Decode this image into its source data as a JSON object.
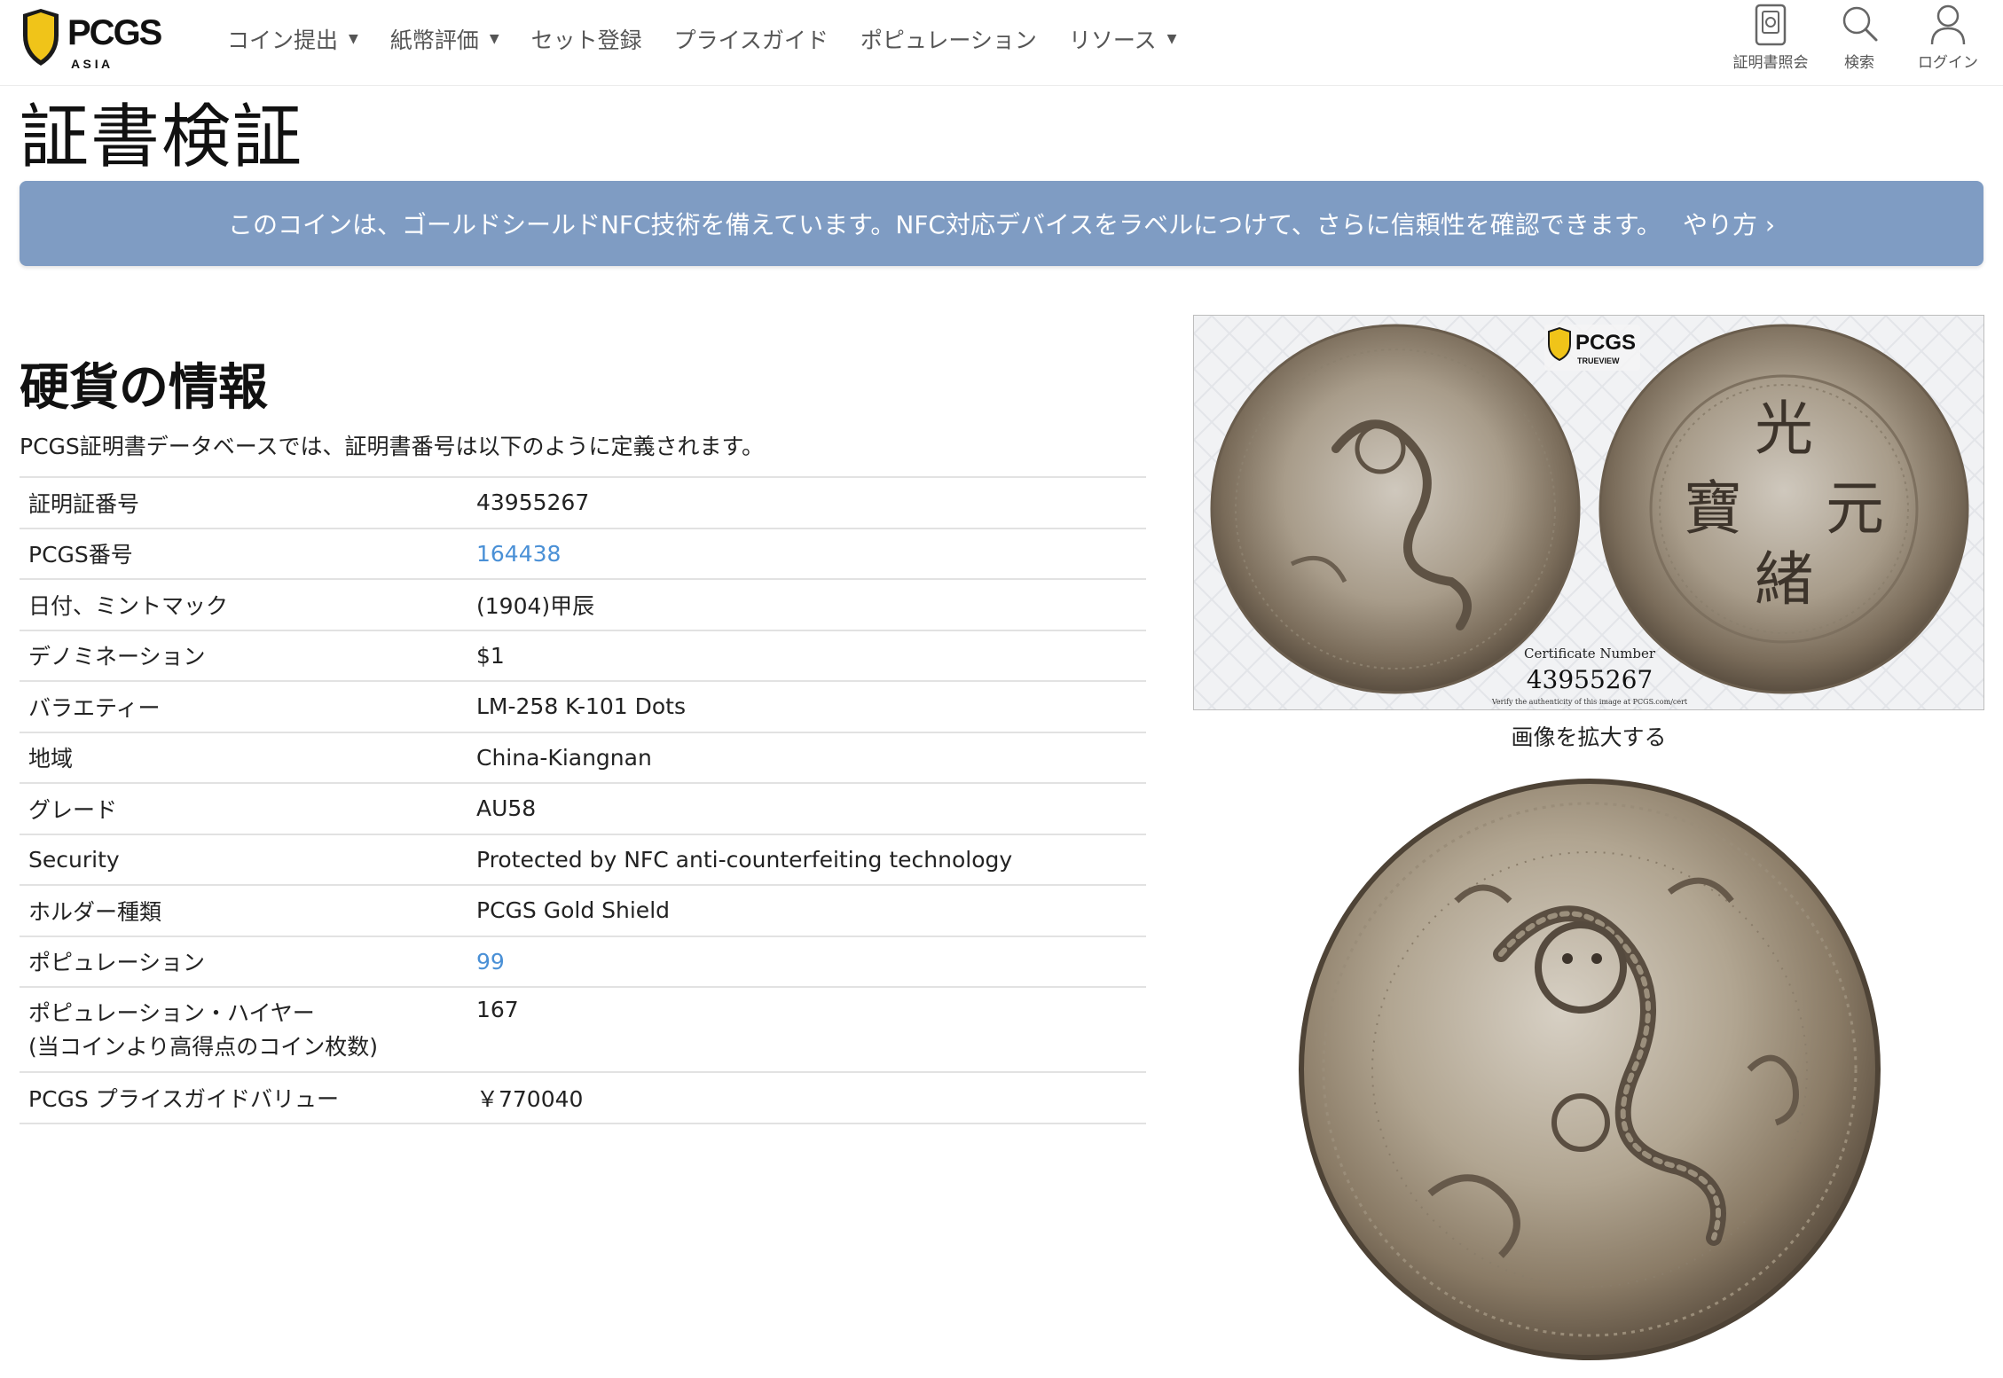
{
  "header": {
    "logo": {
      "brand": "PCGS",
      "sub": "A S I A"
    },
    "nav": [
      {
        "label": "コイン提出",
        "dropdown": true
      },
      {
        "label": "紙幣評価",
        "dropdown": true
      },
      {
        "label": "セット登録",
        "dropdown": false
      },
      {
        "label": "プライスガイド",
        "dropdown": false
      },
      {
        "label": "ポピュレーション",
        "dropdown": false
      },
      {
        "label": "リソース",
        "dropdown": true
      }
    ],
    "icons": [
      {
        "label": "証明書照会",
        "icon": "certificate-icon"
      },
      {
        "label": "検索",
        "icon": "search-icon"
      },
      {
        "label": "ログイン",
        "icon": "user-icon"
      }
    ]
  },
  "page": {
    "title": "証書検証"
  },
  "banner": {
    "text": "このコインは、ゴールドシールドNFC技術を備えています。NFC対応デバイスをラベルにつけて、さらに信頼性を確認できます。",
    "link": "やり方 ›"
  },
  "coin_info": {
    "title": "硬貨の情報",
    "description": "PCGS証明書データベースでは、証明書番号は以下のように定義されます。",
    "rows": [
      {
        "label": "証明証番号",
        "value": "43955267",
        "link": false
      },
      {
        "label": "PCGS番号",
        "value": "164438",
        "link": true
      },
      {
        "label": "日付、ミントマック",
        "value": "(1904)甲辰",
        "link": false
      },
      {
        "label": "デノミネーション",
        "value": "$1",
        "link": false
      },
      {
        "label": "バラエティー",
        "value": "LM-258 K-101 Dots",
        "link": false
      },
      {
        "label": "地域",
        "value": "China-Kiangnan",
        "link": false
      },
      {
        "label": "グレード",
        "value": "AU58",
        "link": false
      },
      {
        "label": "Security",
        "value": "Protected by NFC anti-counterfeiting technology",
        "link": false
      },
      {
        "label": "ホルダー種類",
        "value": "PCGS Gold Shield",
        "link": false
      },
      {
        "label": "ポピュレーション",
        "value": "99",
        "link": true
      },
      {
        "label": "ポピュレーション・ハイヤー",
        "label2": "(当コインより高得点のコイン枚数)",
        "value": "167",
        "link": false
      },
      {
        "label": "PCGS プライスガイドバリュー",
        "value": "￥770040",
        "link": false
      }
    ]
  },
  "images": {
    "slab": {
      "brand": "PCGS",
      "brand_sub": "TRUEVIEW",
      "cert_label": "Certificate Number",
      "cert_number": "43955267",
      "verify_text": "Verify the authenticity of this image at PCGS.com/cert",
      "reverse_chars": [
        "光",
        "元",
        "緒",
        "寶"
      ]
    },
    "zoom_label": "画像を拡大する"
  },
  "colors": {
    "banner": "#7f9cc3",
    "link": "#4a90d6",
    "logo_gold": "#f0c419"
  }
}
